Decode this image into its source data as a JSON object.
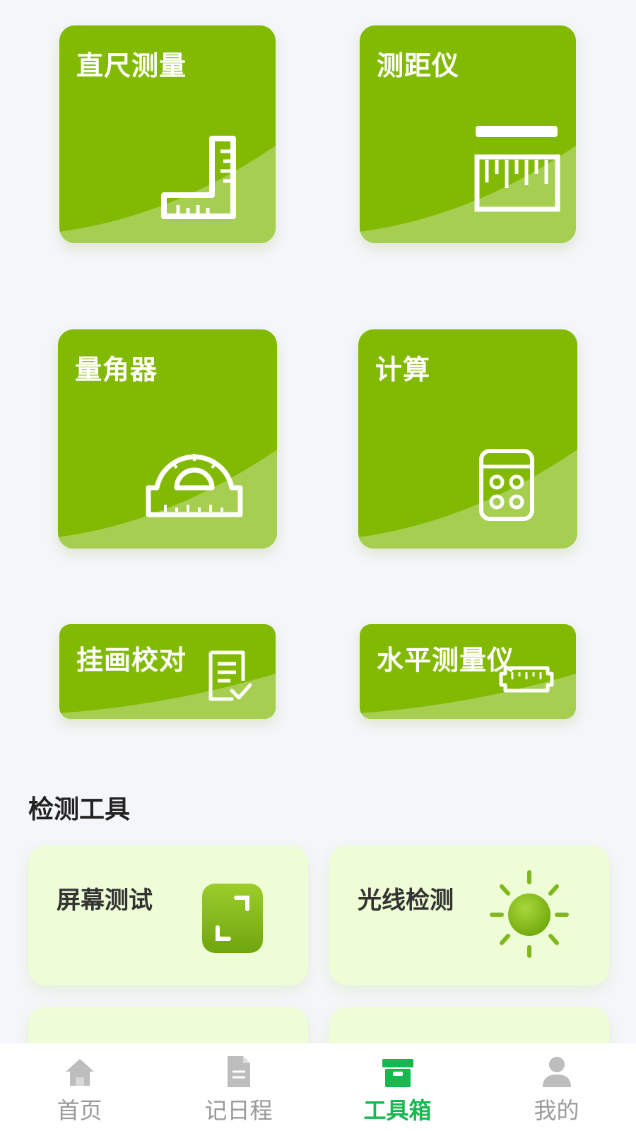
{
  "tools": {
    "ruler": "直尺测量",
    "range_finder": "测距仪",
    "protractor": "量角器",
    "calculator": "计算",
    "frame_align": "挂画校对",
    "level": "水平测量仪"
  },
  "detection": {
    "section_title": "检测工具",
    "screen_test": "屏幕测试",
    "light_test": "光线检测"
  },
  "nav": {
    "home": "首页",
    "schedule": "记日程",
    "toolbox": "工具箱",
    "mine": "我的",
    "active": "toolbox"
  },
  "colors": {
    "card_green": "#82b902",
    "card_wave": "#a6cf52",
    "detect_bg": "#eefdd6",
    "nav_active": "#16b84f",
    "nav_inactive": "#9a9a9a"
  }
}
